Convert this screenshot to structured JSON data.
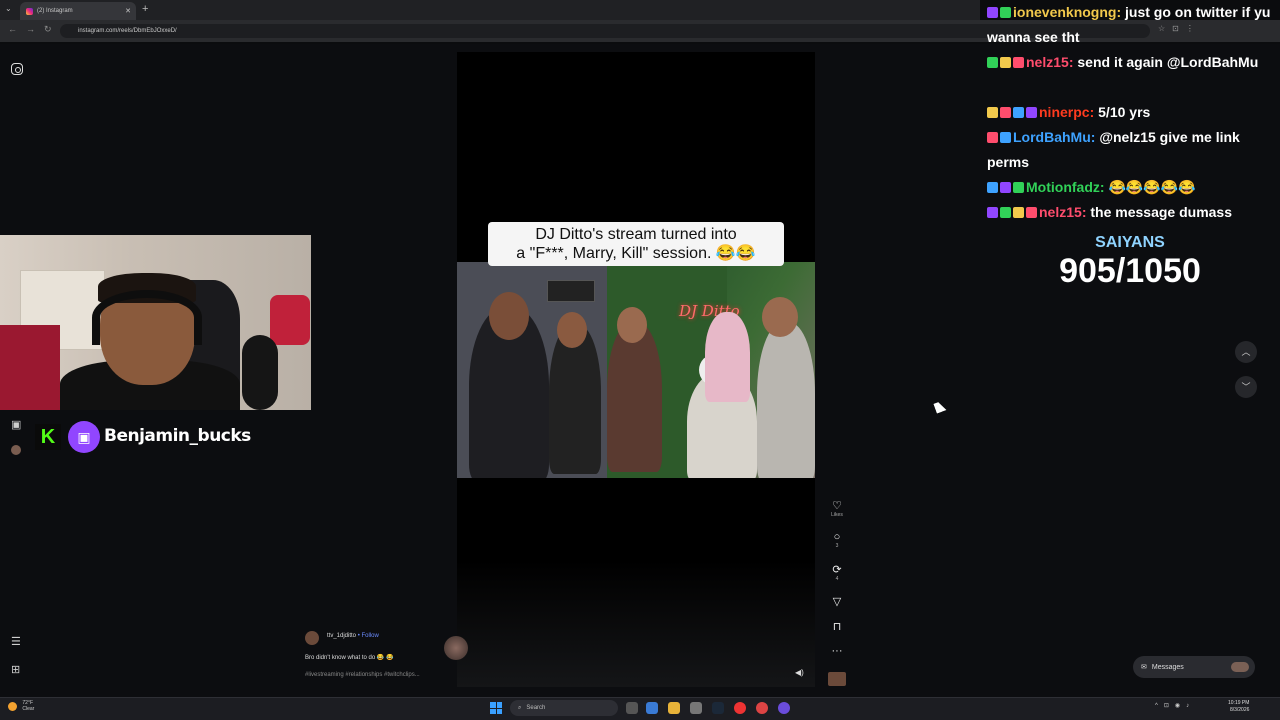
{
  "browser": {
    "tab_title": "(2) Instagram",
    "url": "instagram.com/reels/DbmEbJOxxeD/"
  },
  "reel": {
    "caption_overlay_line1": "DJ Ditto's stream turned into",
    "caption_overlay_line2": "a  \"F***, Marry, Kill\" session. 😂😂",
    "neon_sign": "DJ Ditto",
    "likes_label": "Likes",
    "comments_count": "3",
    "reposts_count": "4",
    "poster_name": "ttv_1djditto",
    "follow_label": "• Follow",
    "caption": "Bro didn't know what to do 😂 😂",
    "hashtags": "#livestreaming #relationships #twitchclips..."
  },
  "messages": {
    "label": "Messages"
  },
  "stream": {
    "handle": "Benjamin_bucks",
    "kick_letter": "K",
    "saiyans_label": "SAIYANS",
    "saiyans_count": "905/1050"
  },
  "chat": [
    {
      "user": "ionevenknogng",
      "message": "just go on twitter if yu wanna see tht",
      "color": "#f2c94c"
    },
    {
      "user": "nelz15",
      "message": "send it again @LordBahMu",
      "color": "#ff4d6d"
    },
    {
      "user": "ninerpc",
      "message": "5/10 yrs",
      "color": "#ff3b1f"
    },
    {
      "user": "LordBahMu",
      "message": "@nelz15 give me link perms",
      "color": "#3ea2ff"
    },
    {
      "user": "Motionfadz",
      "message": "😂😂😂😂😂",
      "color": "#31d158"
    },
    {
      "user": "nelz15",
      "message": "the message dumass",
      "color": "#ff4d6d"
    }
  ],
  "taskbar": {
    "weather_temp": "72°F",
    "weather_desc": "Clear",
    "search_label": "Search",
    "time": "10:19 PM",
    "date": "8/3/2026"
  }
}
